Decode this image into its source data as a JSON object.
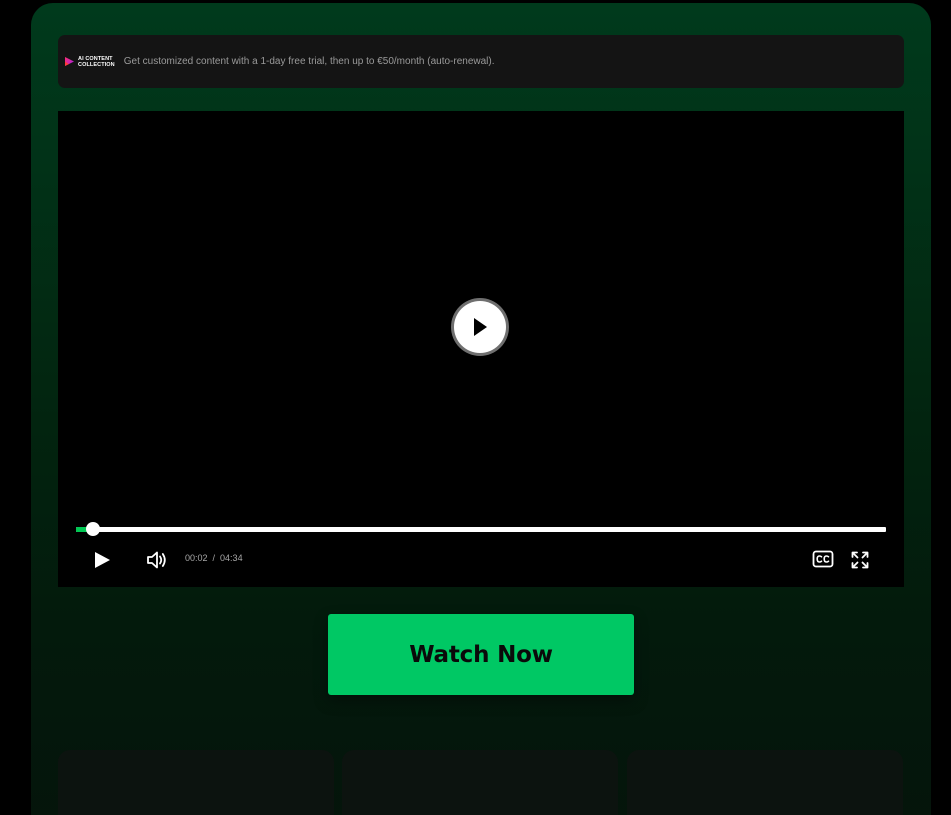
{
  "promo": {
    "brand_line1": "AI CONTENT",
    "brand_line2": "COLLECTION",
    "message": "Get customized content with a 1-day free trial, then up to €50/month (auto-renewal)."
  },
  "player": {
    "current_time": "00:02",
    "separator": "/",
    "duration": "04:34",
    "progress_fraction": 0.0073,
    "icons": {
      "big_play": "play-icon",
      "play": "play-icon",
      "volume": "volume-icon",
      "captions": "closed-captions-icon",
      "fullscreen": "fullscreen-icon"
    }
  },
  "cta": {
    "label": "Watch Now"
  },
  "colors": {
    "accent_green": "#00c864",
    "panel_top": "#003a1c",
    "promo_bg": "#141414"
  }
}
